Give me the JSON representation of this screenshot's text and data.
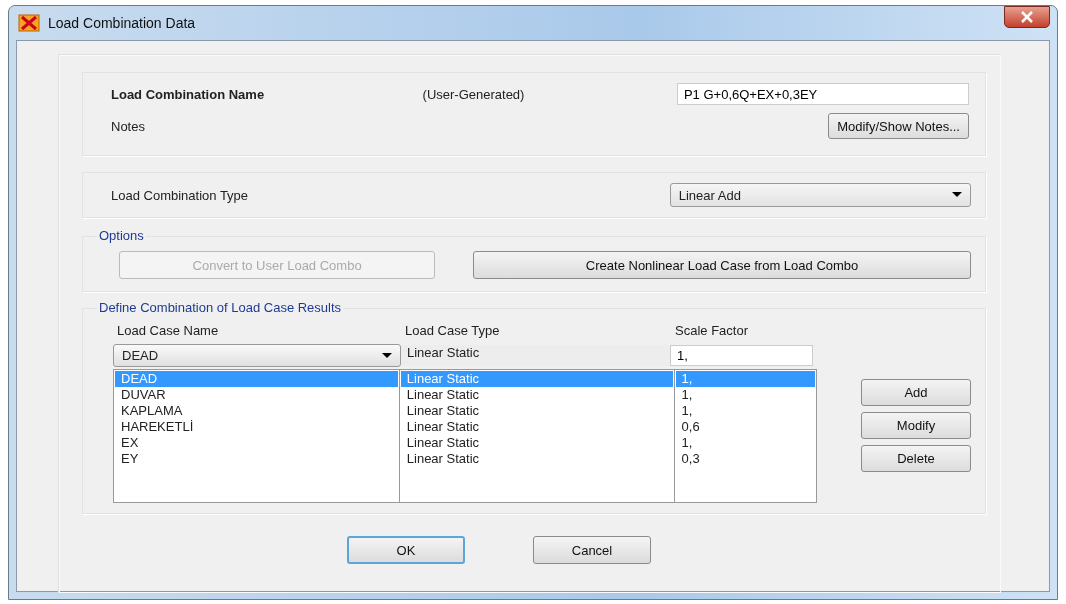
{
  "window": {
    "title": "Load Combination Data"
  },
  "name_section": {
    "label": "Load Combination Name",
    "source": "(User-Generated)",
    "value": "P1 G+0,6Q+EX+0,3EY",
    "notes_label": "Notes",
    "notes_button": "Modify/Show Notes..."
  },
  "type_section": {
    "label": "Load Combination Type",
    "value": "Linear Add"
  },
  "options": {
    "title": "Options",
    "buttons": [
      {
        "label": "Convert to User Load Combo",
        "disabled": true
      },
      {
        "label": "Create Nonlinear Load Case from Load Combo",
        "disabled": false
      }
    ]
  },
  "define": {
    "title": "Define Combination of Load Case Results",
    "columns": [
      "Load Case Name",
      "Load Case Type",
      "Scale Factor"
    ],
    "current": {
      "name": "DEAD",
      "type": "Linear Static",
      "scale": "1,"
    },
    "rows": [
      {
        "name": "DEAD",
        "type": "Linear Static",
        "scale": "1,",
        "selected": true
      },
      {
        "name": "DUVAR",
        "type": "Linear Static",
        "scale": "1,",
        "selected": false
      },
      {
        "name": "KAPLAMA",
        "type": "Linear Static",
        "scale": "1,",
        "selected": false
      },
      {
        "name": "HAREKETLİ",
        "type": "Linear Static",
        "scale": "0,6",
        "selected": false
      },
      {
        "name": "EX",
        "type": "Linear Static",
        "scale": "1,",
        "selected": false
      },
      {
        "name": "EY",
        "type": "Linear Static",
        "scale": "0,3",
        "selected": false
      }
    ],
    "buttons": [
      "Add",
      "Modify",
      "Delete"
    ]
  },
  "footer": [
    {
      "label": "OK",
      "default": true
    },
    {
      "label": "Cancel",
      "default": false
    }
  ]
}
